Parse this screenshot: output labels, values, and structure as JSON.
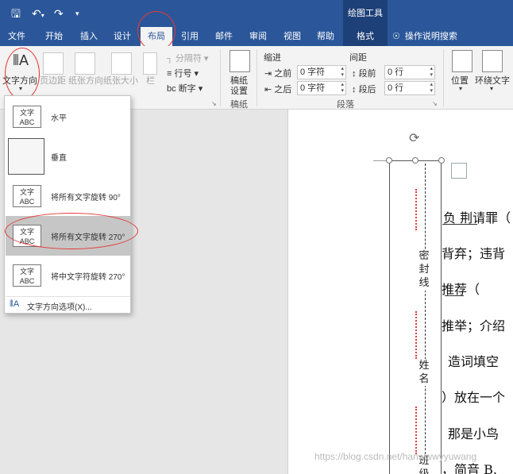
{
  "quick_access": {
    "save_icon": "save-icon",
    "undo_icon": "undo-icon",
    "redo_icon": "redo-icon",
    "customize_icon": "customize-qat-icon"
  },
  "context_tab_group": "绘图工具",
  "tabs": [
    {
      "label": "文件"
    },
    {
      "label": "开始"
    },
    {
      "label": "插入"
    },
    {
      "label": "设计"
    },
    {
      "label": "布局",
      "active": true
    },
    {
      "label": "引用"
    },
    {
      "label": "邮件"
    },
    {
      "label": "审阅"
    },
    {
      "label": "视图"
    },
    {
      "label": "帮助"
    },
    {
      "label": "格式",
      "contextual": true
    }
  ],
  "tell_me": "操作说明搜索",
  "ribbon": {
    "text_direction": "文字方向",
    "margins": "页边距",
    "orientation": "纸张方向",
    "size": "纸张大小",
    "columns": "栏",
    "breaks": "分隔符",
    "line_numbers": "行号",
    "hyphenation": "断字",
    "manuscript_line1": "稿纸",
    "manuscript_line2": "设置",
    "manuscript_group": "稿纸",
    "indent_header": "缩进",
    "spacing_header": "间距",
    "indent_left_label": "之前",
    "indent_left_value": "0 字符",
    "indent_right_label": "之后",
    "indent_right_value": "0 字符",
    "space_before_label": "段前",
    "space_before_value": "0 行",
    "space_after_label": "段后",
    "space_after_value": "0 行",
    "paragraph_group": "段落",
    "position": "位置",
    "wrap_text": "环绕文字"
  },
  "text_direction_menu": {
    "items": [
      {
        "label": "水平",
        "icon": "text-horizontal-icon",
        "icon_text": "文字\nABC"
      },
      {
        "label": "垂直",
        "icon": "text-vertical-icon",
        "icon_text": ""
      },
      {
        "label": "将所有文字旋转 90°",
        "icon": "text-rotate-90-icon",
        "icon_text": "文字\nABC"
      },
      {
        "label": "将所有文字旋转 270°",
        "icon": "text-rotate-270-icon",
        "icon_text": "文字\nABC",
        "selected": true
      },
      {
        "label": "将中文字符旋转 270°",
        "icon": "text-rotate-cjk-270-icon",
        "icon_text": "文字\nABC"
      }
    ],
    "options_label": "文字方向选项(X)..."
  },
  "document": {
    "seal_labels": [
      "密封线",
      "姓名",
      "班级"
    ],
    "lines": [
      "负 荆请罪（",
      "背弃；违背",
      "推荐（",
      "推举；介绍",
      "造词填空",
      "）放在一个",
      "那是小鸟",
      "，简音 B."
    ]
  },
  "watermark": "https://blog.csdn.net/hanwwwyyuwang"
}
